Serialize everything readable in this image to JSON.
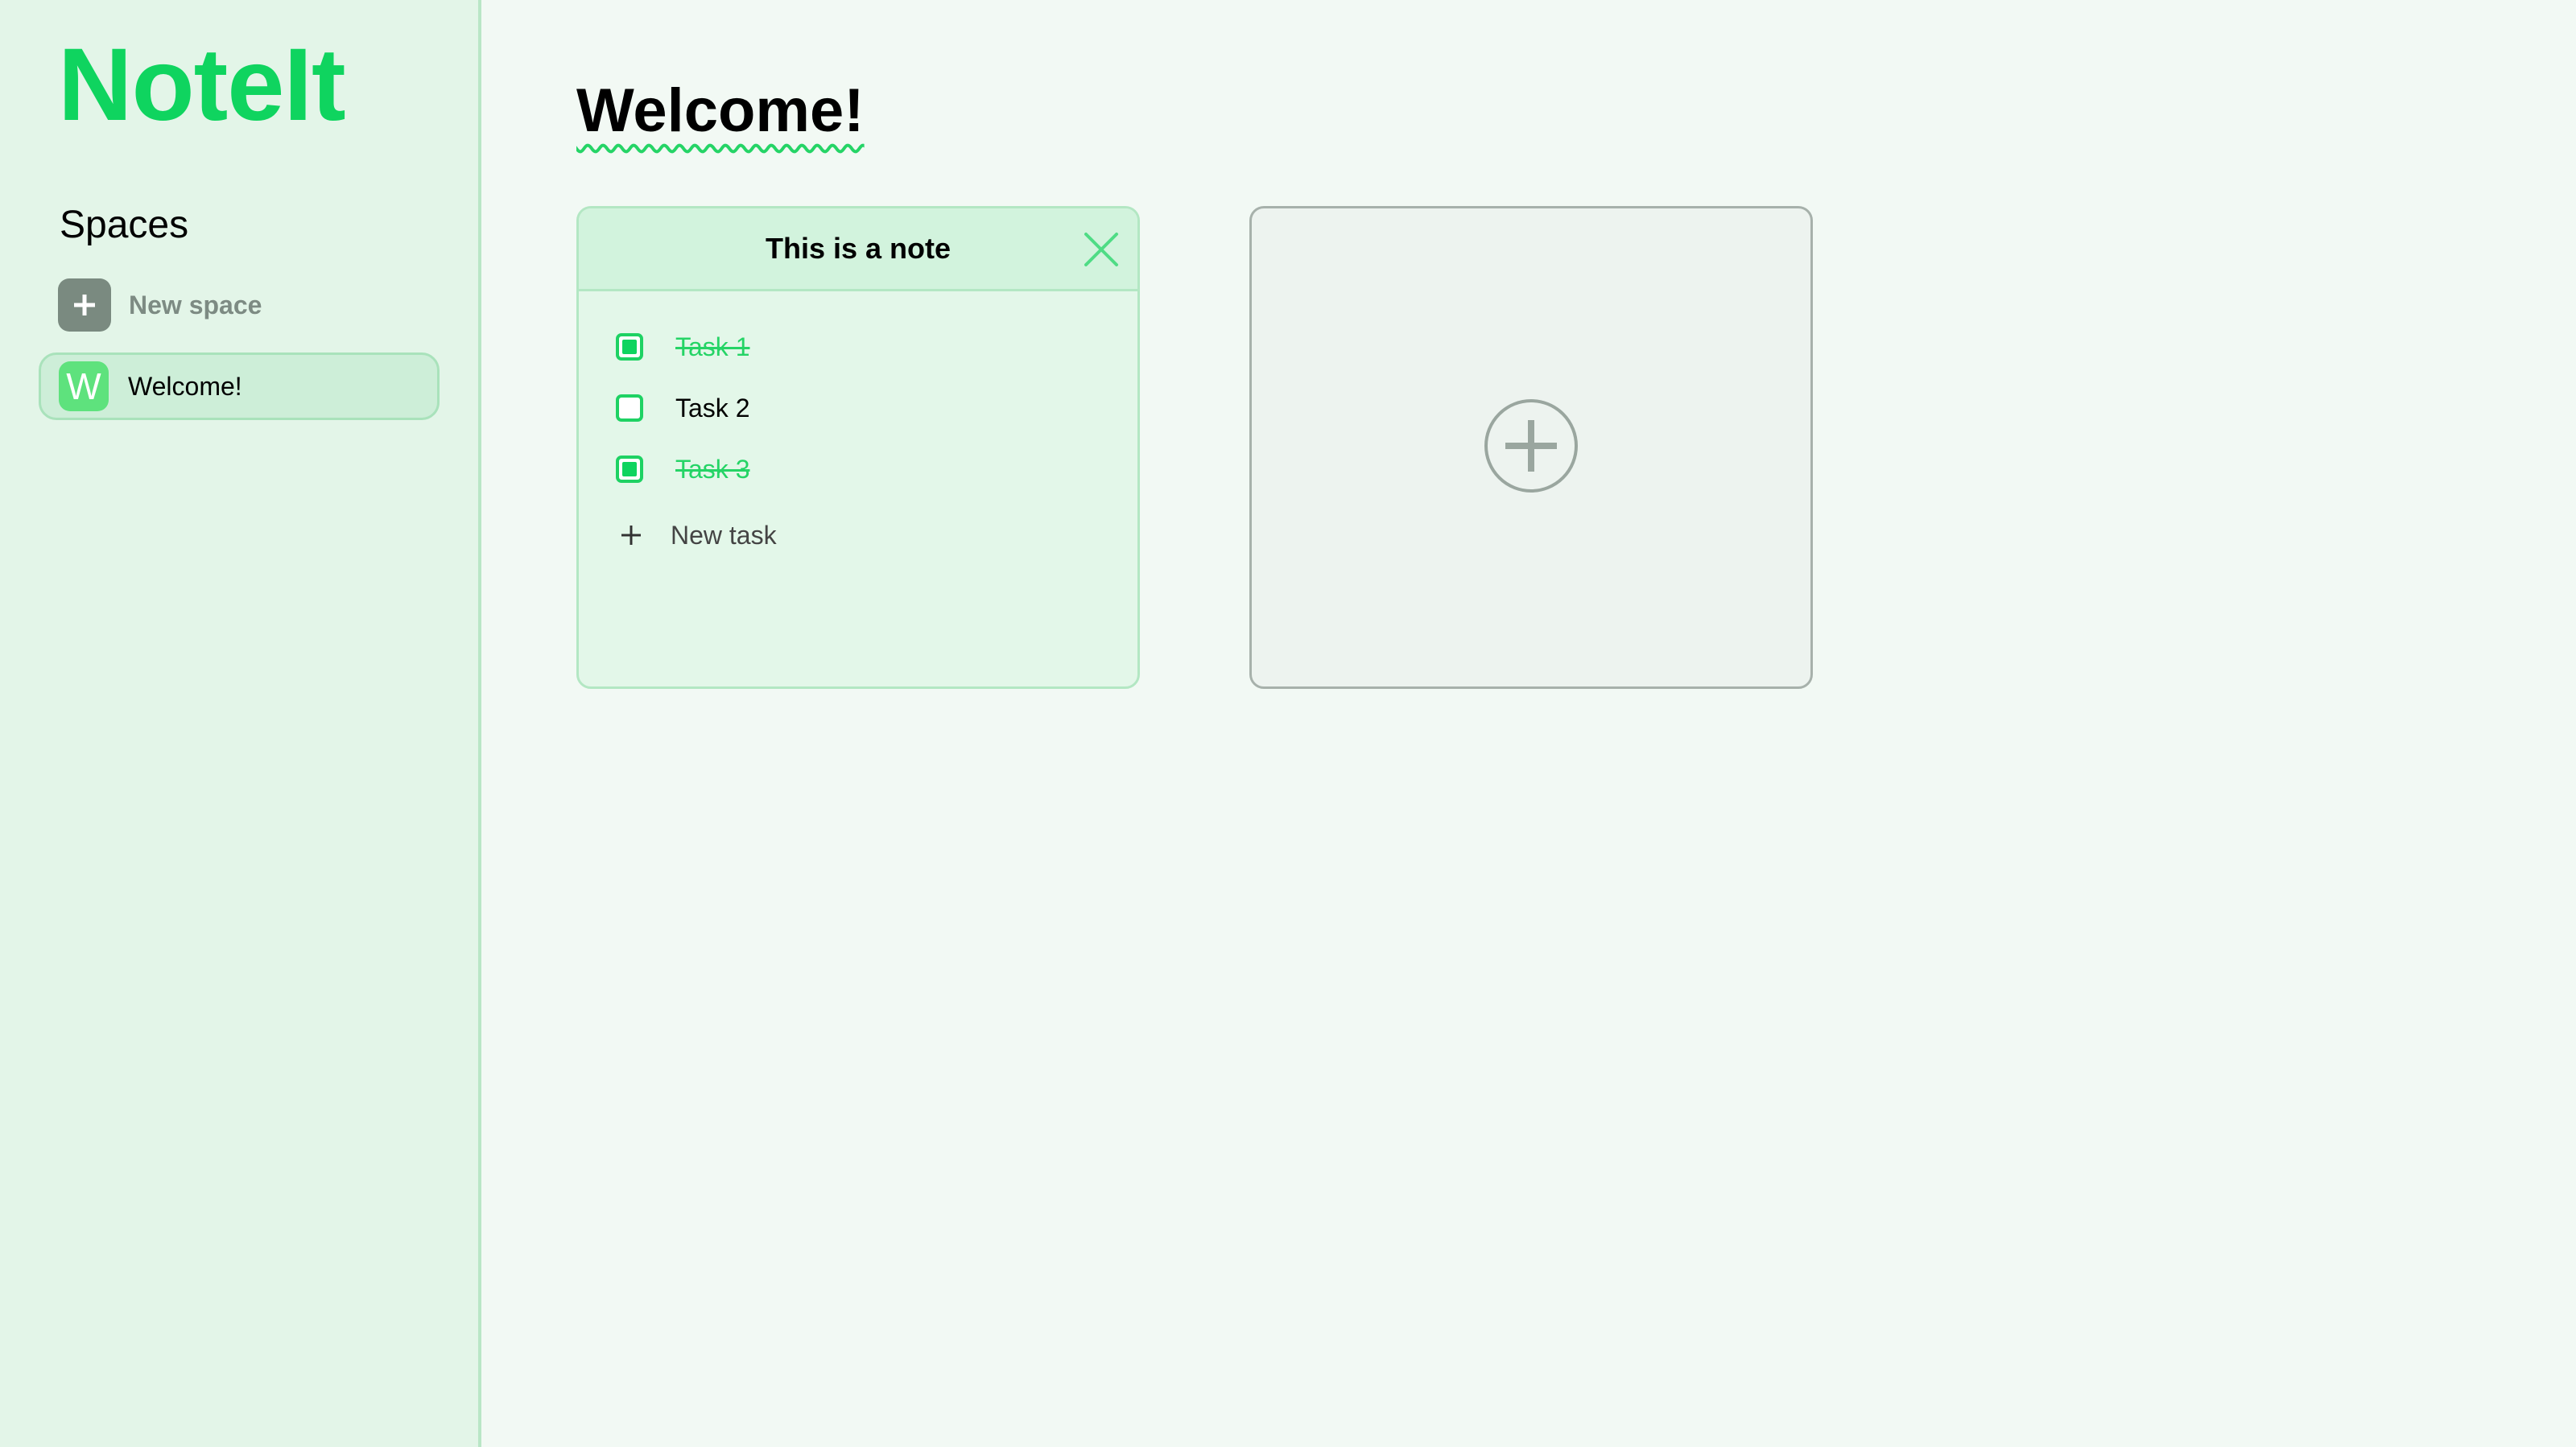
{
  "app": {
    "logo": "NoteIt"
  },
  "sidebar": {
    "heading": "Spaces",
    "new_space_label": "New space",
    "new_space_icon": "plus-icon",
    "spaces": [
      {
        "initial": "W",
        "label": "Welcome!",
        "active": true
      }
    ]
  },
  "main": {
    "title": "Welcome!",
    "notes": [
      {
        "title": "This is a note",
        "close_icon": "close-icon",
        "tasks": [
          {
            "label": "Task 1",
            "done": true
          },
          {
            "label": "Task 2",
            "done": false
          },
          {
            "label": "Task 3",
            "done": true
          }
        ],
        "new_task_label": "New task",
        "new_task_icon": "plus-icon"
      }
    ],
    "add_note_icon": "plus-circle-icon"
  },
  "colors": {
    "brand": "#0fd45f",
    "sidebar_bg": "#e3f5e8",
    "page_bg": "#f2f9f4",
    "note_bg": "#e3f7e9",
    "note_header_bg": "#d2f3dd",
    "add_card_bg": "#edf3ef",
    "muted": "#7a8a80"
  }
}
